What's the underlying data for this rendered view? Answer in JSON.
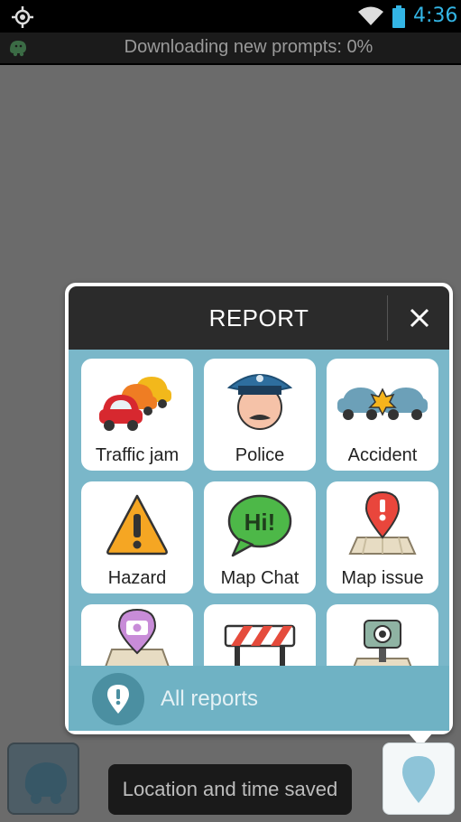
{
  "status_bar": {
    "time": "4:36",
    "time_color": "#33b5e5",
    "icons": [
      "gps-icon",
      "wifi-icon",
      "battery-icon"
    ]
  },
  "notification": {
    "text": "Downloading new prompts: 0%",
    "icon": "waze-icon"
  },
  "report_panel": {
    "title": "REPORT",
    "close_icon": "close-icon",
    "tiles": [
      {
        "label": "Traffic jam",
        "icon": "traffic-jam-icon"
      },
      {
        "label": "Police",
        "icon": "police-icon"
      },
      {
        "label": "Accident",
        "icon": "accident-icon"
      },
      {
        "label": "Hazard",
        "icon": "hazard-icon"
      },
      {
        "label": "Map Chat",
        "icon": "map-chat-icon"
      },
      {
        "label": "Map issue",
        "icon": "map-issue-icon"
      },
      {
        "label": "",
        "icon": "camera-pin-icon"
      },
      {
        "label": "",
        "icon": "road-closure-icon"
      },
      {
        "label": "",
        "icon": "speed-camera-icon"
      }
    ],
    "all_reports_label": "All reports"
  },
  "toast": {
    "text": "Location and time saved"
  },
  "colors": {
    "header": "#2b2b2b",
    "body": "#7ab7c9",
    "all_reports_bar": "#6fb2c4",
    "accent_blue": "#33b5e5"
  }
}
